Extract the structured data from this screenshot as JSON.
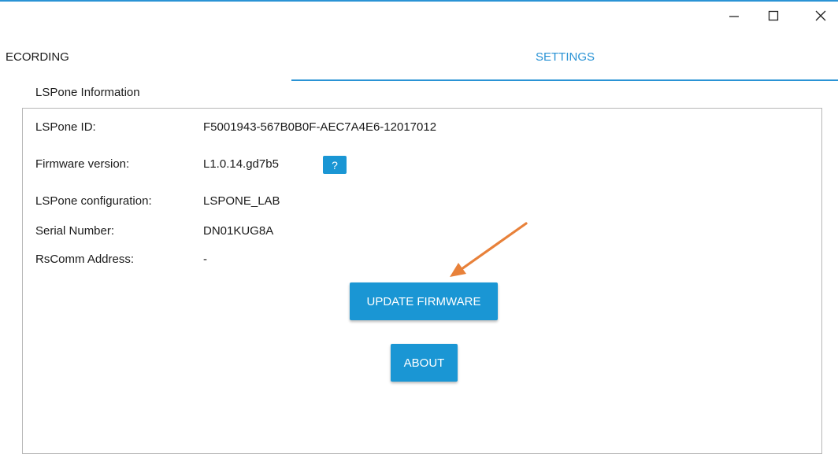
{
  "window": {
    "controls": [
      "minimize",
      "maximize",
      "close"
    ]
  },
  "tabs": [
    {
      "label": "ECORDING",
      "active": false
    },
    {
      "label": "SETTINGS",
      "active": true
    }
  ],
  "section": {
    "title": "LSPone Information",
    "rows": [
      {
        "label": "LSPone ID:",
        "value": "F5001943-567B0B0F-AEC7A4E6-12017012"
      },
      {
        "label": "Firmware version:",
        "value": "L1.0.14.gd7b5"
      },
      {
        "label": "LSPone configuration:",
        "value": "LSPONE_LAB"
      },
      {
        "label": "Serial Number:",
        "value": "DN01KUG8A"
      },
      {
        "label": "RsComm Address:",
        "value": "-"
      }
    ],
    "help_label": "?"
  },
  "buttons": {
    "update_firmware": "UPDATE FIRMWARE",
    "about": "ABOUT"
  },
  "colors": {
    "accent": "#1a96d4",
    "annotation_arrow": "#e8813a"
  }
}
